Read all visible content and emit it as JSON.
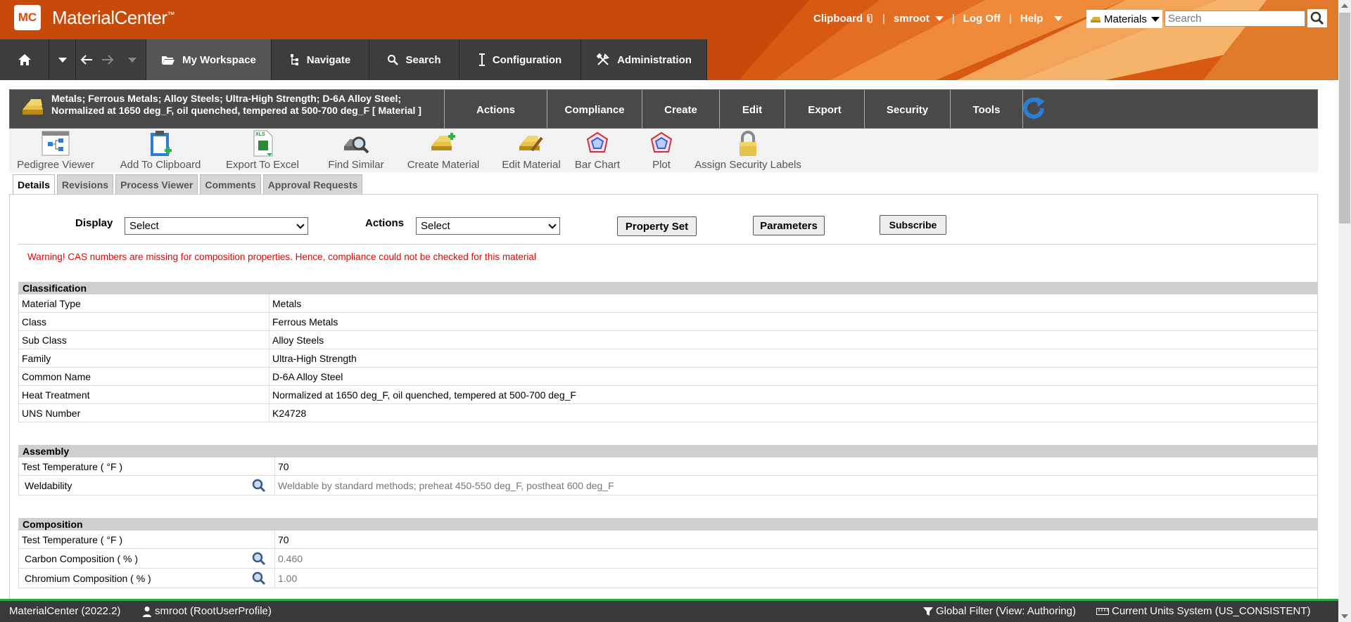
{
  "app": {
    "logo": "MC",
    "name": "MaterialCenter",
    "trademark": "™"
  },
  "top_links": {
    "clipboard": "Clipboard",
    "user": "smroot",
    "logoff": "Log Off",
    "help": "Help",
    "separator": "|"
  },
  "database": {
    "selected": "Materials"
  },
  "search": {
    "placeholder": "Search"
  },
  "nav": {
    "workspace": "My Workspace",
    "navigate": "Navigate",
    "search": "Search",
    "configuration": "Configuration",
    "administration": "Administration"
  },
  "material": {
    "title": "Metals; Ferrous Metals; Alloy Steels; Ultra-High Strength; D-6A Alloy Steel; Normalized at 1650 deg_F, oil quenched, tempered at 500-700 deg_F [ Material ]",
    "menus": [
      "Actions",
      "Compliance",
      "Create",
      "Edit",
      "Export",
      "Security",
      "Tools"
    ]
  },
  "toolbar": [
    "Pedigree Viewer",
    "Add To Clipboard",
    "Export To Excel",
    "Find Similar",
    "Create Material",
    "Edit Material",
    "Bar Chart",
    "Plot",
    "Assign Security Labels"
  ],
  "tabs": [
    "Details",
    "Revisions",
    "Process Viewer",
    "Comments",
    "Approval Requests"
  ],
  "controls": {
    "display_label": "Display",
    "display_value": "Select",
    "actions_label": "Actions",
    "actions_value": "Select",
    "property_set": "Property Set",
    "parameters": "Parameters",
    "subscribe": "Subscribe"
  },
  "warning": "Warning! CAS numbers are missing for composition properties. Hence, compliance could not be checked for this material",
  "classification": {
    "title": "Classification",
    "rows": [
      {
        "k": "Material Type",
        "v": "Metals"
      },
      {
        "k": "Class",
        "v": "Ferrous Metals"
      },
      {
        "k": "Sub Class",
        "v": "Alloy Steels"
      },
      {
        "k": "Family",
        "v": "Ultra-High Strength"
      },
      {
        "k": "Common Name",
        "v": "D-6A Alloy Steel"
      },
      {
        "k": "Heat Treatment",
        "v": "Normalized at 1650 deg_F, oil quenched, tempered at 500-700 deg_F"
      },
      {
        "k": "UNS Number",
        "v": "K24728"
      }
    ]
  },
  "assembly": {
    "title": "Assembly",
    "rows": [
      {
        "k": "Test Temperature ( °F )",
        "v": "70"
      },
      {
        "k": "Weldability",
        "v": "Weldable by standard methods; preheat 450-550 deg_F, postheat 600 deg_F"
      }
    ]
  },
  "composition": {
    "title": "Composition",
    "rows": [
      {
        "k": "Test Temperature ( °F )",
        "v": "70"
      },
      {
        "k": "Carbon Composition ( % )",
        "v": "0.460"
      },
      {
        "k": "Chromium Composition ( % )",
        "v": "1.00"
      }
    ]
  },
  "status": {
    "version": "MaterialCenter (2022.2)",
    "user": "smroot (RootUserProfile)",
    "filter": "Global Filter (View: Authoring)",
    "units": "Current Units System (US_CONSISTENT)"
  },
  "colors": {
    "header": "#c84a0a",
    "nav": "#3d3d3d",
    "warning": "#e00000",
    "status_accent": "#2eab3e"
  }
}
